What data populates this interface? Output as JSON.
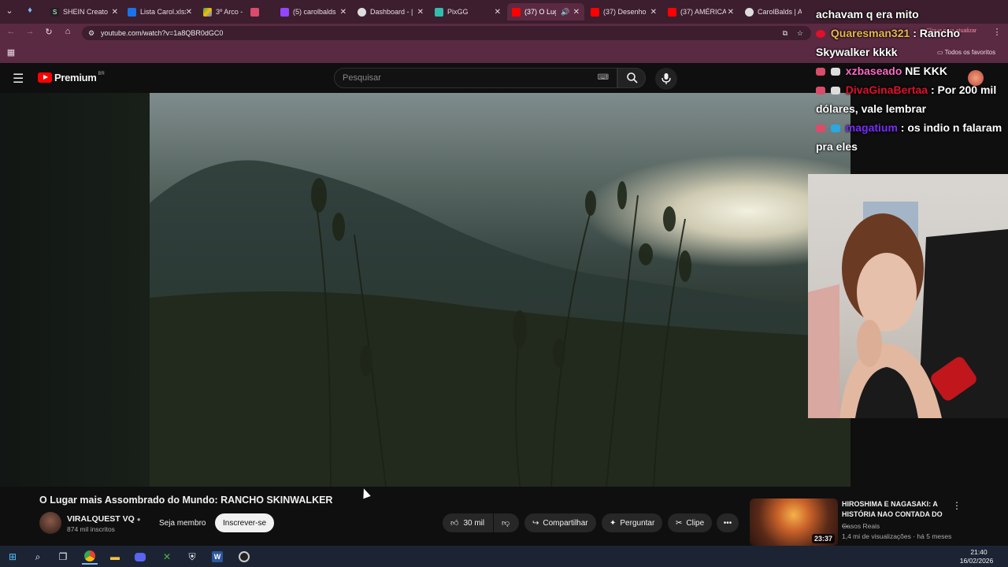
{
  "browser": {
    "tabs": [
      {
        "title": "SHEIN Creato",
        "fav_color": "#222222"
      },
      {
        "title": "Lista Carol.xlsx",
        "fav_color": "#1a73e8"
      },
      {
        "title": "3º Arco -",
        "fav_color": "#34a853"
      },
      {
        "title": "",
        "fav_color": "#d94c6a"
      },
      {
        "title": "(5) carolbalds",
        "fav_color": "#9146ff"
      },
      {
        "title": "Dashboard - |",
        "fav_color": "#dddddd"
      },
      {
        "title": "PixGG",
        "fav_color": "#32bcad"
      },
      {
        "title": "(37) O Lug",
        "fav_color": "#ff0000"
      },
      {
        "title": "(37) Desenho",
        "fav_color": "#ff0000"
      },
      {
        "title": "(37) AMÉRICA",
        "fav_color": "#ff0000"
      },
      {
        "title": "CarolBalds | A",
        "fav_color": "#dddddd"
      }
    ],
    "url": "youtube.com/watch?v=1a8QBR0dGC0",
    "update_label": "Clique para atualizar",
    "bookmarks_label": "Todos os favoritos"
  },
  "youtube": {
    "logo_text": "Premium",
    "logo_badge": "BR",
    "search_placeholder": "Pesquisar",
    "video_title": "O Lugar mais Assombrado do Mundo: RANCHO SKINWALKER",
    "channel_name": "VIRALQUEST VQ",
    "subscribers": "874 mil inscritos",
    "join_label": "Seja membro",
    "subscribe_label": "Inscrever-se",
    "likes": "30 mil",
    "share_label": "Compartilhar",
    "ask_label": "Perguntar",
    "clip_label": "Clipe",
    "rec": {
      "title": "HIROSHIMA E NAGASAKI: A HISTÓRIA NAO CONTADA DO ...",
      "channel": "Casos Reais",
      "meta": "1,4 mi de visualizações · há 5 meses",
      "duration": "23:37"
    }
  },
  "chat": [
    {
      "user": "",
      "text": "achavam q era mito",
      "user_color": "#ffffff"
    },
    {
      "user": "Quaresman321",
      "text": ": Rancho Skywalker kkkk",
      "user_color": "#e8b84a"
    },
    {
      "user": "xzbaseado",
      "text": "NE KKK",
      "user_color": "#ff69c8"
    },
    {
      "user": "DivaGinaBertaa",
      "text": ": Por 200 mil dólares, vale lembrar",
      "user_color": "#e0102a"
    },
    {
      "user": "magatium",
      "text": ": os indio n falaram pra eles",
      "user_color": "#7a2cff"
    }
  ],
  "taskbar": {
    "time": "21:40",
    "date": "16/02/2026"
  }
}
